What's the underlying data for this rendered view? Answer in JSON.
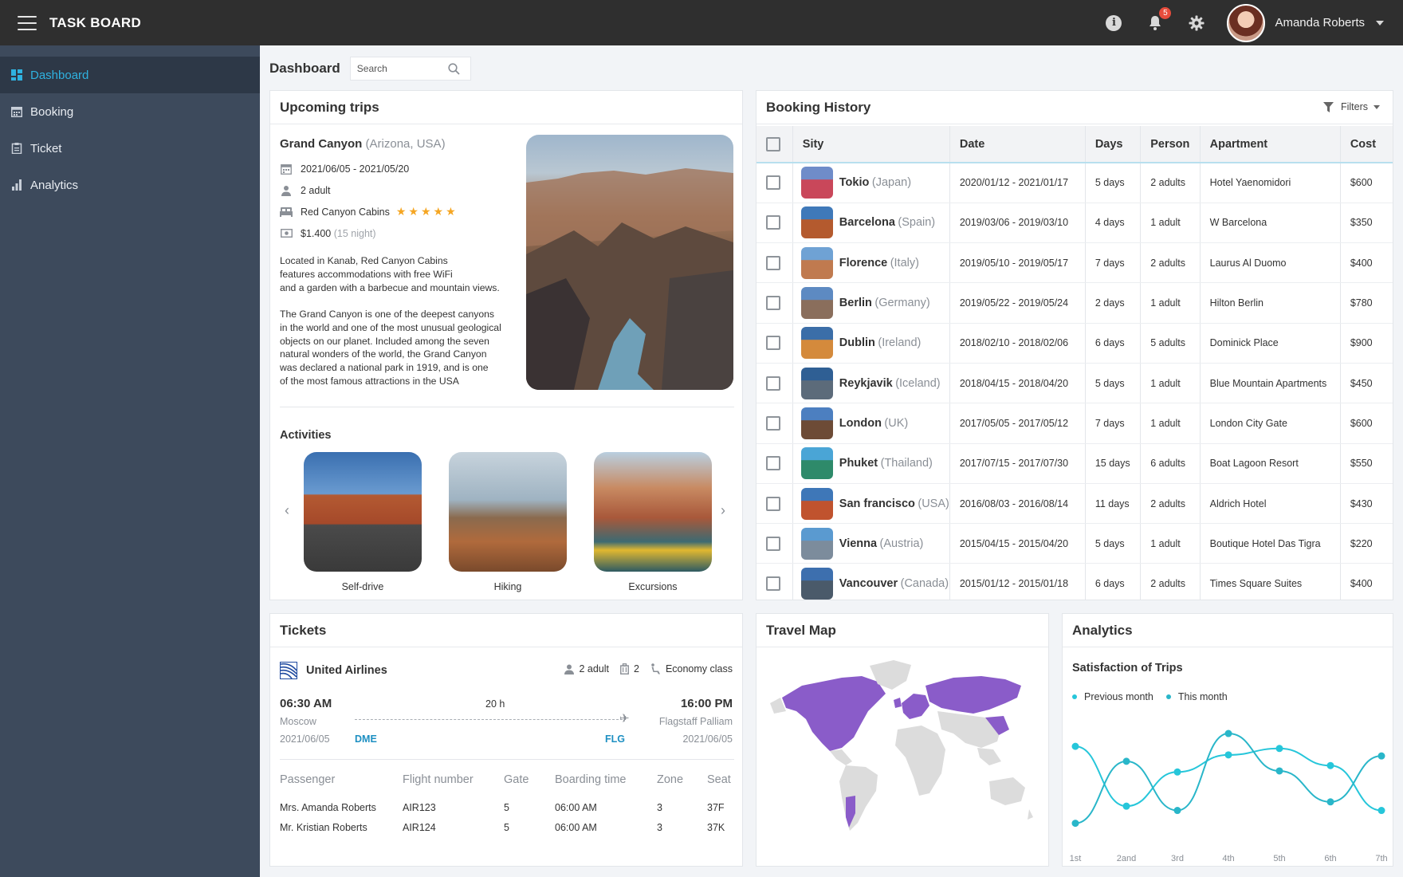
{
  "app": {
    "title": "TASK BOARD"
  },
  "topbar": {
    "notifications_count": "5",
    "user_name": "Amanda Roberts"
  },
  "sidebar": {
    "items": [
      {
        "label": "Dashboard",
        "icon": "dashboard-icon",
        "active": true
      },
      {
        "label": "Booking",
        "icon": "calendar-icon",
        "active": false
      },
      {
        "label": "Ticket",
        "icon": "ticket-icon",
        "active": false
      },
      {
        "label": "Analytics",
        "icon": "bar-chart-icon",
        "active": false
      }
    ]
  },
  "page": {
    "title": "Dashboard",
    "search_placeholder": "Search"
  },
  "upcoming": {
    "title": "Upcoming trips",
    "place": "Grand Canyon",
    "region": "(Arizona, USA)",
    "dates": "2021/06/05 - 2021/05/20",
    "guests": "2 adult",
    "hotel": "Red Canyon Cabins",
    "rating": 5,
    "stars_text": "★★★★★",
    "price": "$1.400",
    "price_note": "(15 night)",
    "desc1": "Located in Kanab, Red Canyon Cabins\nfeatures accommodations with free WiFi\nand a garden with a barbecue and mountain views.",
    "desc2": "The Grand Canyon is one of the deepest canyons\nin the world and one of the most unusual geological\nobjects on our planet. Included among the seven\nnatural wonders of the world, the Grand Canyon\nwas declared a national park in 1919, and is one\nof the most famous attractions in the USA",
    "activities_title": "Activities",
    "activities": [
      "Self-drive",
      "Hiking",
      "Excursions"
    ]
  },
  "booking": {
    "title": "Booking History",
    "filters_label": "Filters",
    "columns": [
      "Sity",
      "Date",
      "Days",
      "Person",
      "Apartment",
      "Cost"
    ],
    "rows": [
      {
        "city": "Tokio",
        "country": "(Japan)",
        "date": "2020/01/12 - 2021/01/17",
        "days": "5 days",
        "person": "2 adults",
        "apartment": "Hotel Yaenomidori",
        "cost": "$600"
      },
      {
        "city": "Barcelona",
        "country": "(Spain)",
        "date": "2019/03/06 - 2019/03/10",
        "days": "4 days",
        "person": "1 adult",
        "apartment": "W Barcelona",
        "cost": "$350"
      },
      {
        "city": "Florence",
        "country": "(Italy)",
        "date": "2019/05/10 - 2019/05/17",
        "days": "7 days",
        "person": "2 adults",
        "apartment": "Laurus Al Duomo",
        "cost": "$400"
      },
      {
        "city": "Berlin",
        "country": "(Germany)",
        "date": "2019/05/22 - 2019/05/24",
        "days": "2 days",
        "person": "1 adult",
        "apartment": "Hilton Berlin",
        "cost": "$780"
      },
      {
        "city": "Dublin",
        "country": "(Ireland)",
        "date": "2018/02/10 - 2018/02/06",
        "days": "6 days",
        "person": "5 adults",
        "apartment": "Dominick Place",
        "cost": "$900"
      },
      {
        "city": "Reykjavik",
        "country": "(Iceland)",
        "date": "2018/04/15 - 2018/04/20",
        "days": "5 days",
        "person": "1 adult",
        "apartment": "Blue Mountain Apartments",
        "cost": "$450"
      },
      {
        "city": "London",
        "country": "(UK)",
        "date": "2017/05/05 - 2017/05/12",
        "days": "7 days",
        "person": "1 adult",
        "apartment": "London City Gate",
        "cost": "$600"
      },
      {
        "city": "Phuket",
        "country": "(Thailand)",
        "date": "2017/07/15 - 2017/07/30",
        "days": "15 days",
        "person": "6 adults",
        "apartment": "Boat Lagoon Resort",
        "cost": "$550"
      },
      {
        "city": "San francisco",
        "country": "(USA)",
        "date": "2016/08/03 - 2016/08/14",
        "days": "11 days",
        "person": "2 adults",
        "apartment": "Aldrich Hotel",
        "cost": "$430"
      },
      {
        "city": "Vienna",
        "country": "(Austria)",
        "date": "2015/04/15 - 2015/04/20",
        "days": "5 days",
        "person": "1 adult",
        "apartment": "Boutique Hotel Das Tigra",
        "cost": "$220"
      },
      {
        "city": "Vancouver",
        "country": "(Canada)",
        "date": "2015/01/12 - 2015/01/18",
        "days": "6 days",
        "person": "2 adults",
        "apartment": "Times Square Suites",
        "cost": "$400"
      }
    ]
  },
  "tickets": {
    "title": "Tickets",
    "airline": "United Airlines",
    "passengers": "2 adult",
    "bags": "2",
    "cabin": "Economy class",
    "depart_time": "06:30 AM",
    "duration": "20 h",
    "arrive_time": "16:00 PM",
    "from_city": "Moscow",
    "to_city": "Flagstaff Palliam",
    "depart_date": "2021/06/05",
    "arrive_date": "2021/06/05",
    "from_code": "DME",
    "to_code": "FLG",
    "columns": [
      "Passenger",
      "Flight number",
      "Gate",
      "Boarding time",
      "Zone",
      "Seat"
    ],
    "rows": [
      {
        "passenger": "Mrs. Amanda Roberts",
        "flight": "AIR123",
        "gate": "5",
        "boarding": "06:00 AM",
        "zone": "3",
        "seat": "37F"
      },
      {
        "passenger": "Mr. Kristian Roberts",
        "flight": "AIR124",
        "gate": "5",
        "boarding": "06:00 AM",
        "zone": "3",
        "seat": "37K"
      }
    ]
  },
  "map": {
    "title": "Travel Map"
  },
  "analytics": {
    "title": "Analytics",
    "chart_title": "Satisfaction of Trips",
    "colors": {
      "previous": "#26c6da",
      "this": "#29b6c9",
      "accent": "#2fb2e0"
    }
  },
  "chart_data": {
    "type": "line",
    "title": "Satisfaction of Trips",
    "categories": [
      "1st",
      "2and",
      "3rd",
      "4th",
      "5th",
      "6th",
      "7th"
    ],
    "series": [
      {
        "name": "Previous month",
        "values": [
          82,
          26,
          58,
          74,
          80,
          64,
          22
        ]
      },
      {
        "name": "This month",
        "values": [
          10,
          68,
          22,
          94,
          59,
          30,
          73
        ]
      }
    ],
    "ylim": [
      0,
      100
    ],
    "grid": false,
    "legend": "top-left"
  }
}
